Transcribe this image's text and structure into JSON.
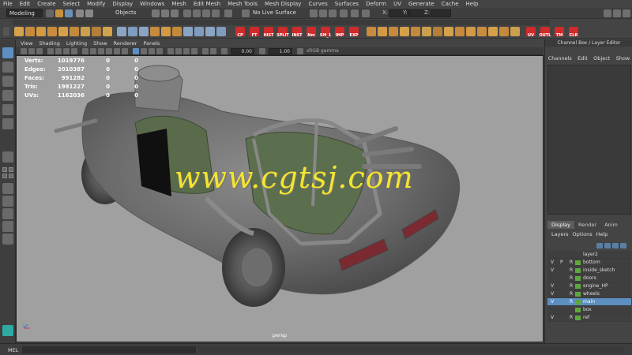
{
  "menubar": [
    "File",
    "Edit",
    "Create",
    "Select",
    "Modify",
    "Display",
    "Windows",
    "Mesh",
    "Edit Mesh",
    "Mesh Tools",
    "Mesh Display",
    "Curves",
    "Surfaces",
    "Deform",
    "UV",
    "Generate",
    "Cache",
    "Help"
  ],
  "statusline": {
    "mode": "Modeling",
    "select_mode": "Objects",
    "live_surface": "No Live Surface",
    "x_label": "X:",
    "y_label": "Y:",
    "z_label": "Z:"
  },
  "shelf_labels": {
    "cp": "CP",
    "ft": "FT",
    "hist": "HIST",
    "split": "SPLIT",
    "inst": "INST",
    "nm": "Nm",
    "sm1": "SM_1",
    "imp": "IMP",
    "exp": "EXP",
    "uv": "UV",
    "outl": "OUTL",
    "tm": "TM",
    "clr": "CLR"
  },
  "panel_menu": [
    "View",
    "Shading",
    "Lighting",
    "Show",
    "Renderer",
    "Panels"
  ],
  "panel_toolbar": {
    "near": "0.00",
    "far": "1.00",
    "gamma": "sRGB gamma"
  },
  "hud": [
    {
      "k": "Verts:",
      "v": "1019776",
      "a": "0",
      "b": "0"
    },
    {
      "k": "Edges:",
      "v": "2010387",
      "a": "0",
      "b": "0"
    },
    {
      "k": "Faces:",
      "v": "991282",
      "a": "0",
      "b": "0"
    },
    {
      "k": "Tris:",
      "v": "1981227",
      "a": "0",
      "b": "0"
    },
    {
      "k": "UVs:",
      "v": "1162036",
      "a": "0",
      "b": "0"
    }
  ],
  "viewport": {
    "camera": "persp",
    "watermark": "www.cgtsj.com"
  },
  "right_panel": {
    "title": "Channel Box / Layer Editor",
    "menu": [
      "Channels",
      "Edit",
      "Object",
      "Show"
    ],
    "tabs": [
      "Display",
      "Render",
      "Anim"
    ],
    "layer_menu": [
      "Layers",
      "Options",
      "Help"
    ],
    "layers": [
      {
        "v": "",
        "p": "",
        "r": "",
        "name": "layer2",
        "swatch": false,
        "selected": false
      },
      {
        "v": "V",
        "p": "P",
        "r": "R",
        "name": "bottom",
        "swatch": true,
        "selected": false
      },
      {
        "v": "V",
        "p": "",
        "r": "R",
        "name": "inside_sketch",
        "swatch": true,
        "selected": false
      },
      {
        "v": "",
        "p": "",
        "r": "R",
        "name": "doors",
        "swatch": true,
        "selected": false
      },
      {
        "v": "V",
        "p": "",
        "r": "R",
        "name": "engine_HP",
        "swatch": true,
        "selected": false
      },
      {
        "v": "V",
        "p": "",
        "r": "R",
        "name": "wheels",
        "swatch": true,
        "selected": false
      },
      {
        "v": "V",
        "p": "",
        "r": "R",
        "name": "main",
        "swatch": true,
        "selected": true
      },
      {
        "v": "",
        "p": "",
        "r": "",
        "name": "box",
        "swatch": true,
        "selected": false
      },
      {
        "v": "V",
        "p": "",
        "r": "R",
        "name": "ref",
        "swatch": true,
        "selected": false
      }
    ]
  },
  "commandline": {
    "label": "MEL"
  },
  "colors": {
    "swatch": "#5fa83c",
    "selected": "#5c8fc0",
    "watermark": "#f5e431",
    "viewport_bg": "#a0a0a0"
  }
}
